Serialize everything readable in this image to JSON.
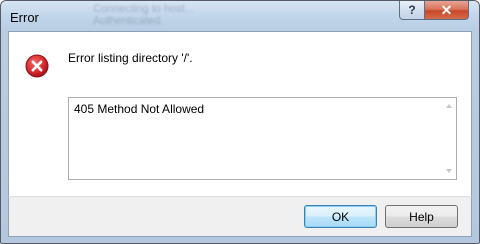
{
  "window": {
    "title": "Error",
    "help_glyph": "?",
    "close_glyph": "✕",
    "ghost_line1": "Connecting to host...",
    "ghost_line2": "Authenticated."
  },
  "dialog": {
    "icon": "error-icon",
    "message": "Error listing directory '/'.",
    "details": "405 Method Not Allowed"
  },
  "buttons": {
    "ok_label": "OK",
    "help_label": "Help"
  },
  "colors": {
    "error_red": "#d6262b",
    "close_button": "#c8482a"
  }
}
